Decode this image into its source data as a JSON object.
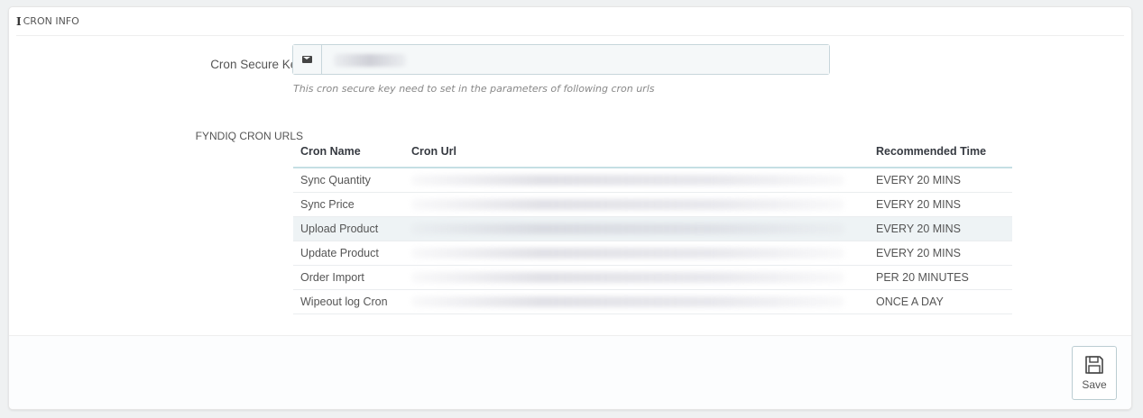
{
  "panel": {
    "heading": "CRON INFO",
    "heading_icon": "info-icon"
  },
  "secure_key": {
    "label": "Cron Secure Key",
    "icon": "envelope-icon",
    "value": "",
    "help": "This cron secure key need to set in the parameters of following cron urls"
  },
  "cron_urls": {
    "label": "FYNDIQ CRON URLS",
    "columns": {
      "name": "Cron Name",
      "url": "Cron Url",
      "time": "Recommended Time"
    },
    "rows": [
      {
        "name": "Sync Quantity",
        "url": "",
        "time": "EVERY 20 MINS"
      },
      {
        "name": "Sync Price",
        "url": "",
        "time": "EVERY 20 MINS"
      },
      {
        "name": "Upload Product",
        "url": "",
        "time": "EVERY 20 MINS"
      },
      {
        "name": "Update Product",
        "url": "",
        "time": "EVERY 20 MINS"
      },
      {
        "name": "Order Import",
        "url": "",
        "time": "PER 20 MINUTES"
      },
      {
        "name": "Wipeout log Cron",
        "url": "",
        "time": "ONCE A DAY"
      }
    ]
  },
  "footer": {
    "save_label": "Save",
    "save_icon": "floppy-disk-icon"
  }
}
